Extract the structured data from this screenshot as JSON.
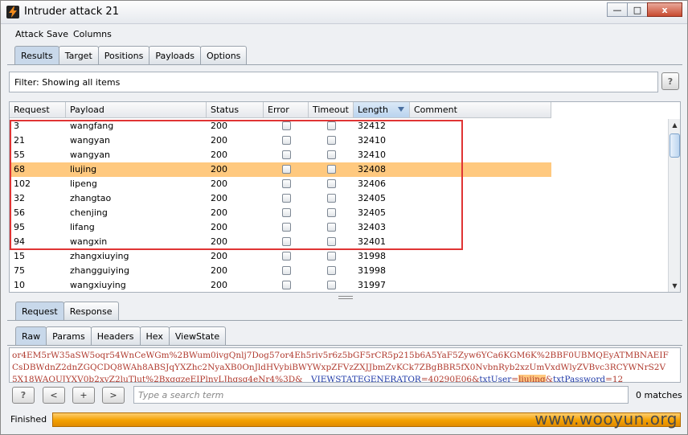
{
  "window": {
    "title": "Intruder attack 21",
    "minimize": "—",
    "maximize": "□",
    "close": "x"
  },
  "menu": [
    "Attack",
    "Save",
    "Columns"
  ],
  "top_tabs": [
    "Results",
    "Target",
    "Positions",
    "Payloads",
    "Options"
  ],
  "filter": {
    "text": "Filter:  Showing all items",
    "help": "?"
  },
  "table": {
    "columns": [
      "Request",
      "Payload",
      "Status",
      "Error",
      "Timeout",
      "Length",
      "Comment"
    ],
    "rows": [
      {
        "request": "3",
        "payload": "wangfang",
        "status": "200",
        "length": "32412"
      },
      {
        "request": "21",
        "payload": "wangyan",
        "status": "200",
        "length": "32410"
      },
      {
        "request": "55",
        "payload": "wangyan",
        "status": "200",
        "length": "32410"
      },
      {
        "request": "68",
        "payload": "liujing",
        "status": "200",
        "length": "32408"
      },
      {
        "request": "102",
        "payload": "lipeng",
        "status": "200",
        "length": "32406"
      },
      {
        "request": "32",
        "payload": "zhangtao",
        "status": "200",
        "length": "32405"
      },
      {
        "request": "56",
        "payload": "chenjing",
        "status": "200",
        "length": "32405"
      },
      {
        "request": "95",
        "payload": "lifang",
        "status": "200",
        "length": "32403"
      },
      {
        "request": "94",
        "payload": "wangxin",
        "status": "200",
        "length": "32401"
      },
      {
        "request": "15",
        "payload": "zhangxiuying",
        "status": "200",
        "length": "31998"
      },
      {
        "request": "75",
        "payload": "zhangguiying",
        "status": "200",
        "length": "31998"
      },
      {
        "request": "10",
        "payload": "wangxiuying",
        "status": "200",
        "length": "31997"
      }
    ],
    "highlighted_row": 3
  },
  "req_tabs": [
    "Request",
    "Response"
  ],
  "view_tabs": [
    "Raw",
    "Params",
    "Headers",
    "Hex",
    "ViewState"
  ],
  "raw": {
    "line1": "or4EM5rW35aSW5oqr54WnCeWGm%2BWum0ivgQnlj7Dog57or4Eh5riv5r6z5bGF5rCR5p215b6A5YaF5Zyw6YCa6KGM6K%2BBF0UBMQEyATMBNAEIF",
    "line2": "CsDBWdnZ2dnZGQCDQ8WAh8ABSJqYXZhc2NyaXB0OnJldHVybiBWYWxpZFVzZXJJbmZvKCk7ZBgBBR5fX0NvbnRyb2xzUmVxdWlyZVBvc3RCYWNrS2V",
    "line3_a": "5X18WAQUJYXV0b2xvZ2luTlut%2BxgqzeEIPlnyLJhgsg4eNr4%3D&",
    "line3_b": "__VIEWSTATEGENERATOR",
    "line3_c": "=40290E06&",
    "line3_d": "txtUser",
    "line3_e": "=",
    "line3_f": "liujing",
    "line3_g": "&",
    "line3_h": "txtPassword",
    "line3_i": "=12"
  },
  "search": {
    "help": "?",
    "prev": "<",
    "add": "+",
    "next": ">",
    "placeholder": "Type a search term",
    "matches": "0 matches"
  },
  "status": {
    "label": "Finished",
    "progress": 1.0
  },
  "watermark": "www.wooyun.org",
  "colors": {
    "highlight": "#ffc97f",
    "progress": "#f3a000",
    "red_box": "#e03434"
  }
}
